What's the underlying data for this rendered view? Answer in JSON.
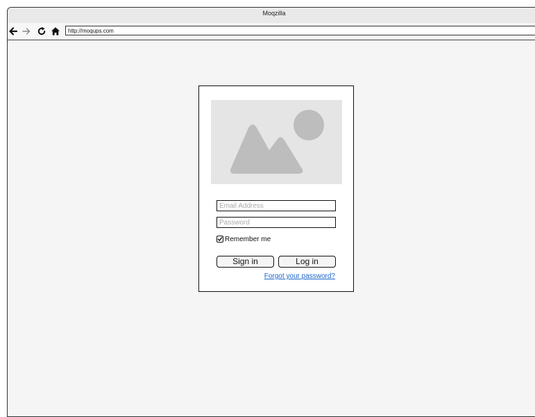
{
  "window": {
    "title": "Moqzilla"
  },
  "toolbar": {
    "back_icon": "back-arrow-icon",
    "forward_icon": "forward-arrow-icon",
    "reload_icon": "reload-icon",
    "home_icon": "home-icon",
    "url": "http://moqups.com"
  },
  "login": {
    "image_icon": "image-placeholder-icon",
    "email_placeholder": "Email Address",
    "password_placeholder": "Password",
    "remember_checked": true,
    "remember_label": "Remember me",
    "signin_label": "Sign in",
    "login_label": "Log in",
    "forgot_label": "Forgot your password?"
  },
  "colors": {
    "link": "#1a66cc",
    "image_fill": "#bdbdbd",
    "image_background": "#e5e5e5",
    "window_background": "#f5f5f5"
  }
}
